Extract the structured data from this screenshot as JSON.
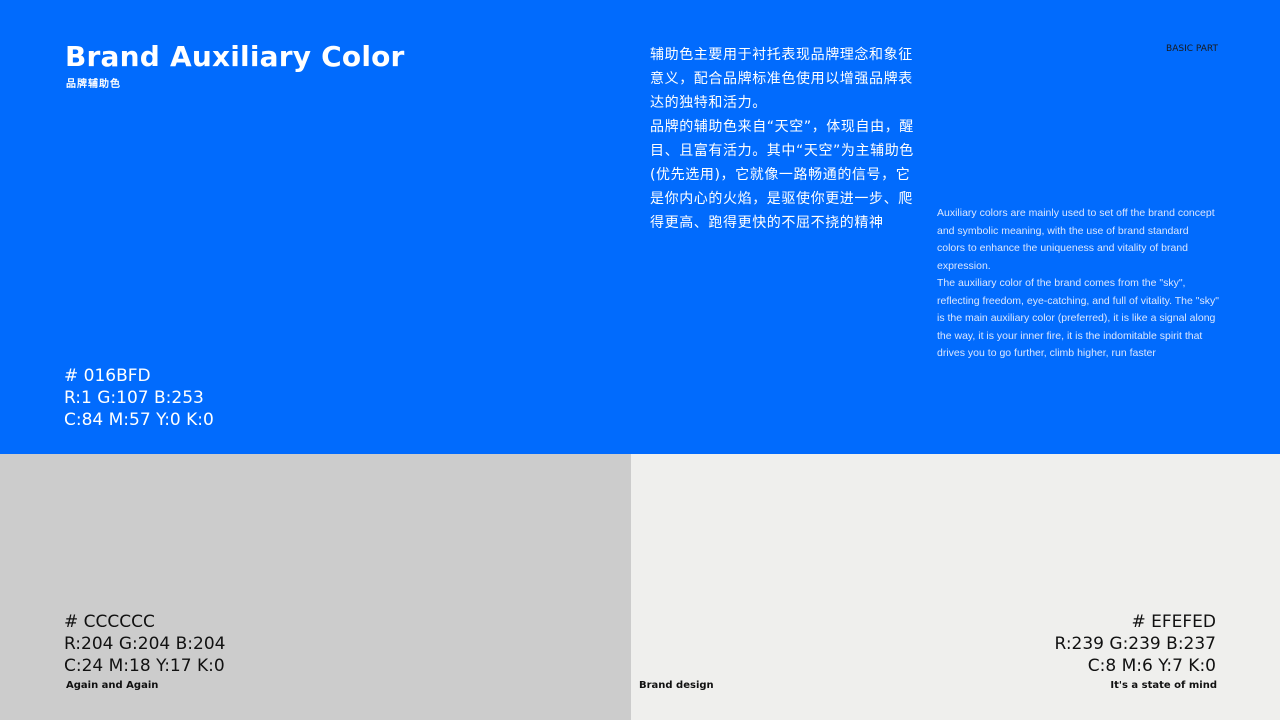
{
  "header": {
    "title": "Brand Auxiliary Color",
    "subtitle": "品牌辅助色",
    "tag": "BASIC PART"
  },
  "description_cn": [
    "辅助色主要用于衬托表现品牌理念和象征意义，配合品牌标准色使用以增强品牌表达的独特和活力。",
    "品牌的辅助色来自“天空”，体现自由，醒目、且富有活力。其中“天空”为主辅助色(优先选用)，它就像一路畅通的信号，它是你内心的火焰，是驱使你更进一步、爬得更高、跑得更快的不屈不挠的精神"
  ],
  "description_en": [
    "Auxiliary colors are mainly used to set off the brand concept and symbolic meaning, with the use of brand standard colors to enhance the uniqueness and vitality of brand expression.",
    "The auxiliary color of the brand comes from the \"sky\", reflecting freedom, eye-catching, and full of vitality. The \"sky\" is the main auxiliary color (preferred), it is like a signal along the way, it is your inner fire, it is the indomitable spirit that drives you to go further, climb higher, run faster"
  ],
  "swatches": [
    {
      "color": "#016BFD",
      "hex": "# 016BFD",
      "rgb": "R:1 G:107 B:253",
      "cmyk": "C:84 M:57 Y:0 K:0"
    },
    {
      "color": "#CCCCCC",
      "hex": "# CCCCCC",
      "rgb": "R:204 G:204 B:204",
      "cmyk": "C:24 M:18 Y:17 K:0",
      "caption": "Again and Again"
    },
    {
      "color": "#EFEFED",
      "hex": "# EFEFED",
      "rgb": "R:239 G:239 B:237",
      "cmyk": "C:8 M:6 Y:7 K:0",
      "caption_left": "Brand design",
      "caption_right": "It's a state of mind"
    }
  ]
}
